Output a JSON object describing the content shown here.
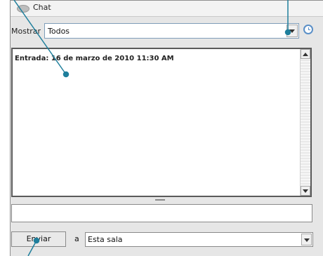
{
  "window": {
    "title": "Chat"
  },
  "filter": {
    "label": "Mostrar",
    "value": "Todos"
  },
  "log": {
    "entry": "Entrada: 16 de marzo de 2010 11:30 AM"
  },
  "composer": {
    "message": "",
    "send_label": "Enviar",
    "to_label": "a",
    "room": "Esta sala"
  },
  "colors": {
    "callout": "#1f7f9c",
    "panel": "#e6e6e6"
  },
  "icons": [
    "chat-bubble-icon",
    "dropdown-arrow-icon",
    "history-clock-icon",
    "scroll-up-icon",
    "scroll-down-icon"
  ]
}
